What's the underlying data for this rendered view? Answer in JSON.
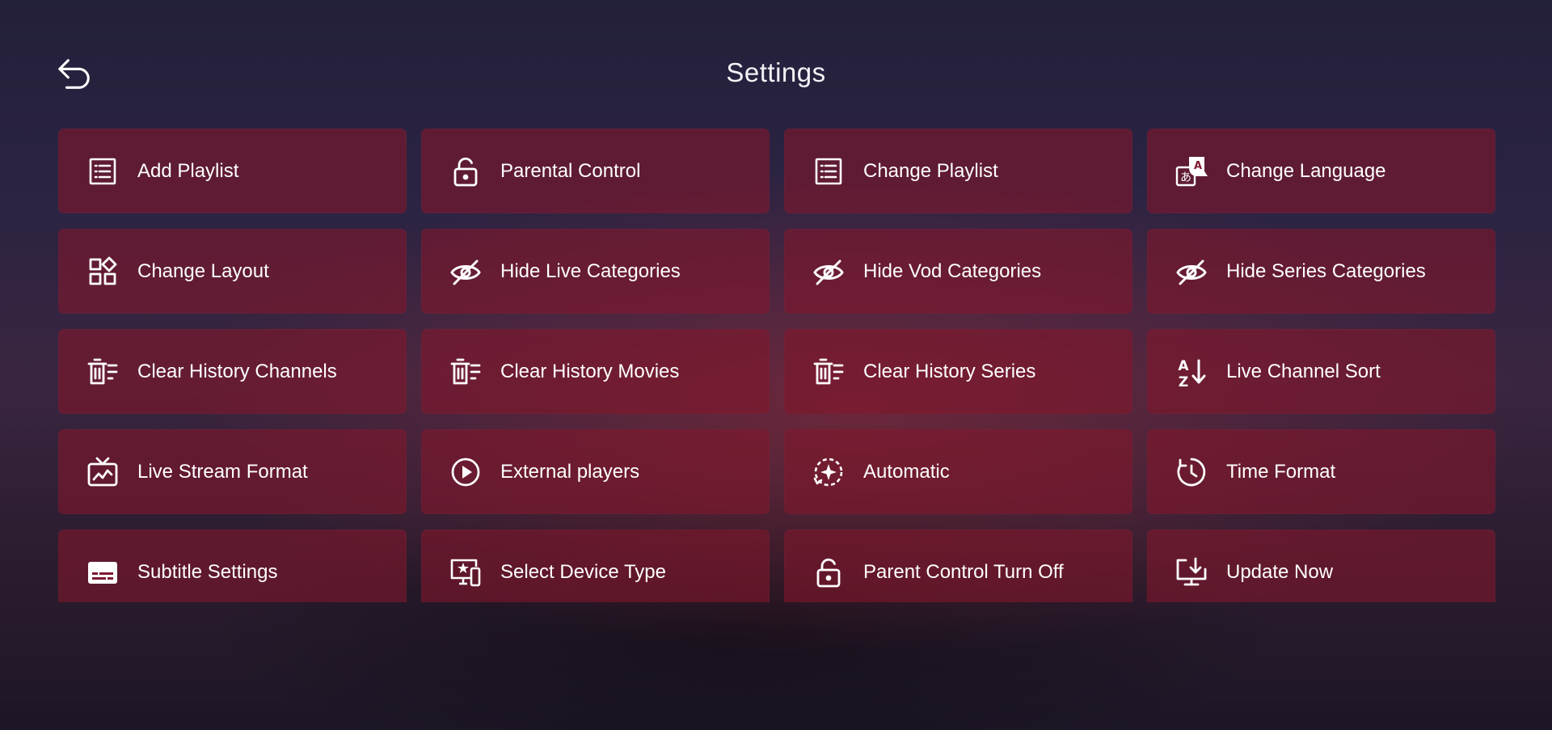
{
  "header": {
    "title": "Settings"
  },
  "settings": {
    "items": [
      {
        "label": "Add Playlist",
        "icon": "list-icon"
      },
      {
        "label": "Parental Control",
        "icon": "lock-icon"
      },
      {
        "label": "Change Playlist",
        "icon": "list-icon"
      },
      {
        "label": "Change Language",
        "icon": "translate-icon"
      },
      {
        "label": "Change Layout",
        "icon": "layout-icon"
      },
      {
        "label": "Hide Live Categories",
        "icon": "eye-off-icon"
      },
      {
        "label": "Hide Vod Categories",
        "icon": "eye-off-icon"
      },
      {
        "label": "Hide Series Categories",
        "icon": "eye-off-icon"
      },
      {
        "label": "Clear History Channels",
        "icon": "clear-history-icon"
      },
      {
        "label": "Clear History Movies",
        "icon": "clear-history-icon"
      },
      {
        "label": "Clear History Series",
        "icon": "clear-history-icon"
      },
      {
        "label": "Live Channel Sort",
        "icon": "sort-az-icon"
      },
      {
        "label": "Live Stream Format",
        "icon": "live-tv-icon"
      },
      {
        "label": "External players",
        "icon": "play-circle-icon"
      },
      {
        "label": "Automatic",
        "icon": "auto-icon"
      },
      {
        "label": "Time Format",
        "icon": "clock-icon"
      },
      {
        "label": "Subtitle Settings",
        "icon": "subtitles-icon"
      },
      {
        "label": "Select Device Type",
        "icon": "devices-icon"
      },
      {
        "label": "Parent Control Turn Off",
        "icon": "lock-icon"
      },
      {
        "label": "Update Now",
        "icon": "download-icon"
      }
    ]
  },
  "theme": {
    "card_color": "#7e1a30",
    "text_color": "#ffffff"
  }
}
